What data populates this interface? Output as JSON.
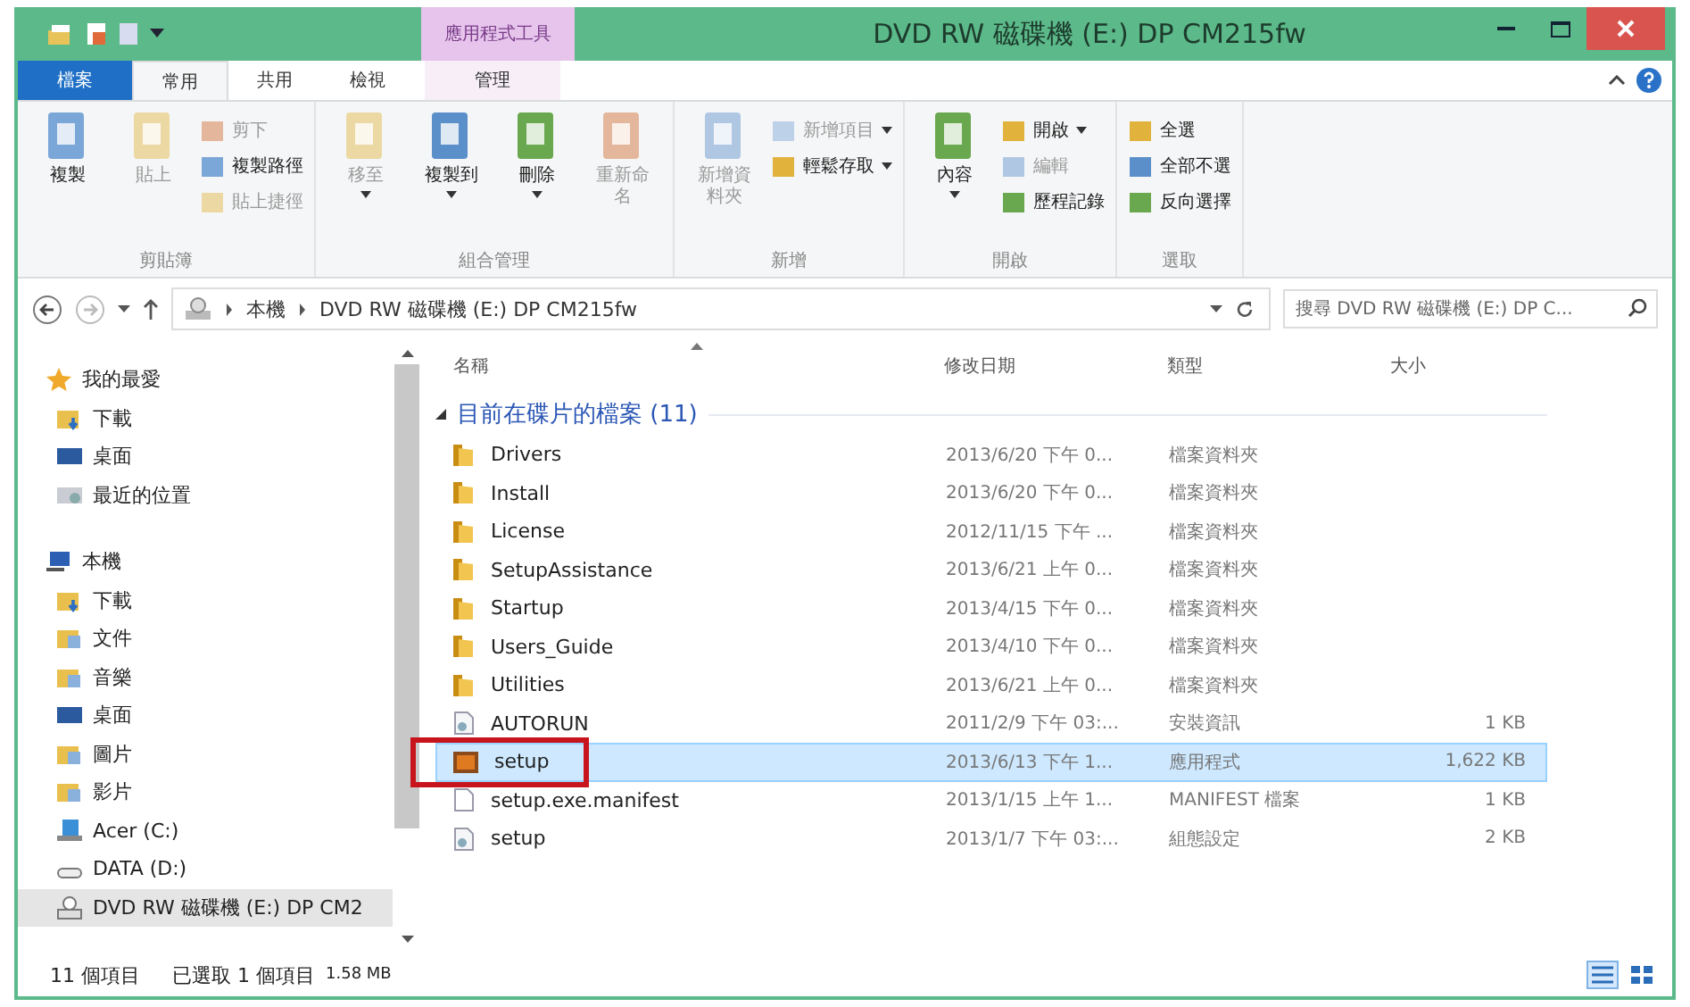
{
  "title_bar": {
    "title": "DVD RW 磁碟機 (E:) DP CM215fw",
    "context_tab_label": "應用程式工具"
  },
  "ribbon_tabs": [
    {
      "label": "檔案",
      "kind": "file",
      "selected": false
    },
    {
      "label": "常用",
      "kind": "tab",
      "selected": true
    },
    {
      "label": "共用",
      "kind": "tab",
      "selected": false
    },
    {
      "label": "檢視",
      "kind": "tab",
      "selected": false
    },
    {
      "label": "管理",
      "kind": "context",
      "selected": false
    }
  ],
  "ribbon_groups": [
    {
      "name": "剪貼簿",
      "items": [
        {
          "label": "複製",
          "kind": "large",
          "disabled": false,
          "dropdown": false
        },
        {
          "label": "貼上",
          "kind": "large",
          "disabled": true,
          "dropdown": false
        },
        {
          "label": "剪下",
          "kind": "small",
          "disabled": true,
          "dropdown": false
        },
        {
          "label": "複製路徑",
          "kind": "small",
          "disabled": false,
          "dropdown": false
        },
        {
          "label": "貼上捷徑",
          "kind": "small",
          "disabled": true,
          "dropdown": false
        }
      ]
    },
    {
      "name": "組合管理",
      "items": [
        {
          "label": "移至",
          "kind": "large",
          "disabled": true,
          "dropdown": true
        },
        {
          "label": "複製到",
          "kind": "large",
          "disabled": false,
          "dropdown": true
        },
        {
          "label": "刪除",
          "kind": "large",
          "disabled": false,
          "dropdown": true
        },
        {
          "label": "重新命名",
          "kind": "large",
          "disabled": true,
          "dropdown": false
        }
      ]
    },
    {
      "name": "新增",
      "items": [
        {
          "label": "新增資料夾",
          "kind": "large",
          "disabled": true,
          "dropdown": false
        },
        {
          "label": "新增項目",
          "kind": "small",
          "disabled": true,
          "dropdown": true
        },
        {
          "label": "輕鬆存取",
          "kind": "small",
          "disabled": false,
          "dropdown": true
        }
      ]
    },
    {
      "name": "開啟",
      "items": [
        {
          "label": "內容",
          "kind": "large",
          "disabled": false,
          "dropdown": true
        },
        {
          "label": "開啟",
          "kind": "small",
          "disabled": false,
          "dropdown": true
        },
        {
          "label": "編輯",
          "kind": "small",
          "disabled": true,
          "dropdown": false
        },
        {
          "label": "歷程記錄",
          "kind": "small",
          "disabled": false,
          "dropdown": false
        }
      ]
    },
    {
      "name": "選取",
      "items": [
        {
          "label": "全選",
          "kind": "small",
          "disabled": false,
          "dropdown": false
        },
        {
          "label": "全部不選",
          "kind": "small",
          "disabled": false,
          "dropdown": false
        },
        {
          "label": "反向選擇",
          "kind": "small",
          "disabled": false,
          "dropdown": false
        }
      ]
    }
  ],
  "address_bar": {
    "path": [
      "本機",
      "DVD RW 磁碟機 (E:) DP CM215fw"
    ],
    "search_placeholder": "搜尋 DVD RW 磁碟機 (E:) DP C..."
  },
  "sidebar": {
    "items": [
      {
        "label": "我的最愛",
        "kind": "star",
        "selected": false,
        "children": [
          {
            "label": "下載",
            "kind": "download",
            "selected": false
          },
          {
            "label": "桌面",
            "kind": "desktop",
            "selected": false
          },
          {
            "label": "最近的位置",
            "kind": "recent",
            "selected": false
          }
        ]
      },
      {
        "label": "本機",
        "kind": "computer",
        "selected": false,
        "children": [
          {
            "label": "下載",
            "kind": "download",
            "selected": false
          },
          {
            "label": "文件",
            "kind": "folder",
            "selected": false
          },
          {
            "label": "音樂",
            "kind": "folder",
            "selected": false
          },
          {
            "label": "桌面",
            "kind": "desktop",
            "selected": false
          },
          {
            "label": "圖片",
            "kind": "folder",
            "selected": false
          },
          {
            "label": "影片",
            "kind": "folder",
            "selected": false
          },
          {
            "label": "Acer (C:)",
            "kind": "drive",
            "selected": false
          },
          {
            "label": "DATA (D:)",
            "kind": "disk",
            "selected": false
          },
          {
            "label": "DVD RW 磁碟機 (E:) DP CM2",
            "kind": "disc",
            "selected": true
          }
        ]
      }
    ]
  },
  "file_list": {
    "columns": [
      "名稱",
      "修改日期",
      "類型",
      "大小"
    ],
    "group_label": "目前在碟片的檔案 (11)",
    "rows": [
      {
        "name": "Drivers",
        "date": "2013/6/20 下午 0...",
        "type": "檔案資料夾",
        "size": "",
        "kind": "folder",
        "selected": false,
        "highlighted": false
      },
      {
        "name": "Install",
        "date": "2013/6/20 下午 0...",
        "type": "檔案資料夾",
        "size": "",
        "kind": "folder",
        "selected": false,
        "highlighted": false
      },
      {
        "name": "License",
        "date": "2012/11/15 下午 ...",
        "type": "檔案資料夾",
        "size": "",
        "kind": "folder",
        "selected": false,
        "highlighted": false
      },
      {
        "name": "SetupAssistance",
        "date": "2013/6/21 上午 0...",
        "type": "檔案資料夾",
        "size": "",
        "kind": "folder",
        "selected": false,
        "highlighted": false
      },
      {
        "name": "Startup",
        "date": "2013/4/15 下午 0...",
        "type": "檔案資料夾",
        "size": "",
        "kind": "folder",
        "selected": false,
        "highlighted": false
      },
      {
        "name": "Users_Guide",
        "date": "2013/4/10 下午 0...",
        "type": "檔案資料夾",
        "size": "",
        "kind": "folder",
        "selected": false,
        "highlighted": false
      },
      {
        "name": "Utilities",
        "date": "2013/6/21 上午 0...",
        "type": "檔案資料夾",
        "size": "",
        "kind": "folder",
        "selected": false,
        "highlighted": false
      },
      {
        "name": "AUTORUN",
        "date": "2011/2/9 下午 03:...",
        "type": "安裝資訊",
        "size": "1 KB",
        "kind": "setting",
        "selected": false,
        "highlighted": false
      },
      {
        "name": "setup",
        "date": "2013/6/13 下午 1...",
        "type": "應用程式",
        "size": "1,622 KB",
        "kind": "program",
        "selected": true,
        "highlighted": true
      },
      {
        "name": "setup.exe.manifest",
        "date": "2013/1/15 上午 1...",
        "type": "MANIFEST 檔案",
        "size": "1 KB",
        "kind": "file",
        "selected": false,
        "highlighted": false
      },
      {
        "name": "setup",
        "date": "2013/1/7 下午 03:...",
        "type": "組態設定",
        "size": "2 KB",
        "kind": "setting",
        "selected": false,
        "highlighted": false
      }
    ]
  },
  "status_bar": {
    "item_count": "11 個項目",
    "selection": "已選取 1 個項目",
    "selection_size": "1.58 MB"
  },
  "view_buttons": [
    {
      "kind": "details",
      "selected": true
    },
    {
      "kind": "large_icons",
      "selected": false
    }
  ]
}
